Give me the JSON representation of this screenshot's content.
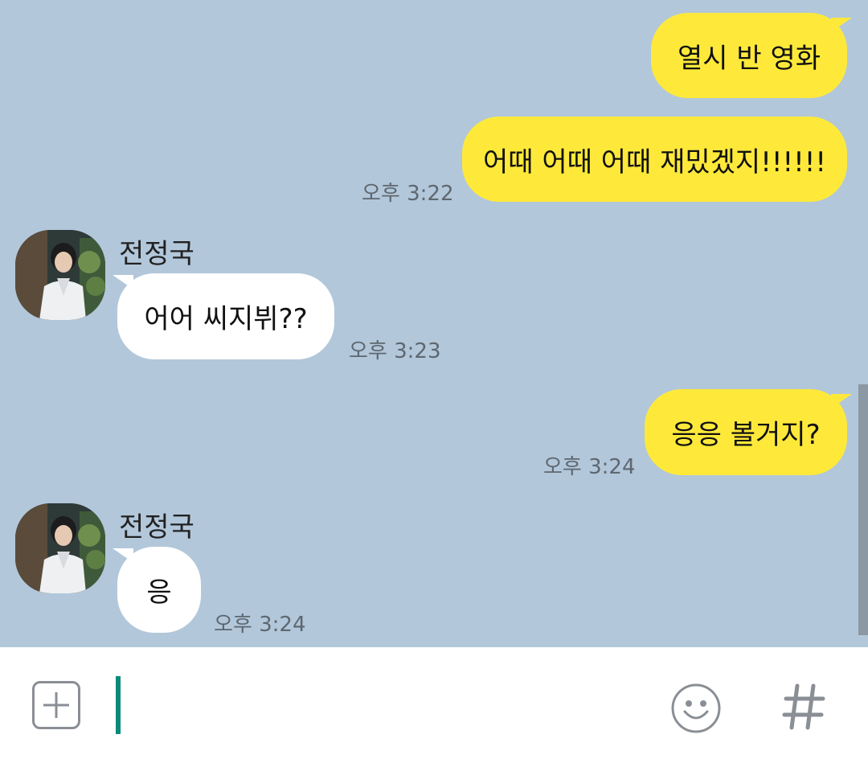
{
  "colors": {
    "chat_background": "#b2c7da",
    "my_bubble": "#fee93a",
    "their_bubble": "#ffffff",
    "caret": "#0a8a7a"
  },
  "messages": [
    {
      "from": "me",
      "text": "열시 반 영화"
    },
    {
      "from": "me",
      "text": "어때 어때 어때 재밌겠지!!!!!!",
      "time": "오후 3:22"
    },
    {
      "from": "them",
      "sender": "전정국",
      "text": "어어 씨지뷔??",
      "time": "오후 3:23"
    },
    {
      "from": "me",
      "text": "응응 볼거지?",
      "time": "오후 3:24"
    },
    {
      "from": "them",
      "sender": "전정국",
      "text": "응",
      "time": "오후 3:24"
    }
  ],
  "composer": {
    "value": "",
    "attach_icon": "plus-square-icon",
    "emoji_icon": "smiley-icon",
    "hashtag_icon": "hashtag-icon"
  }
}
